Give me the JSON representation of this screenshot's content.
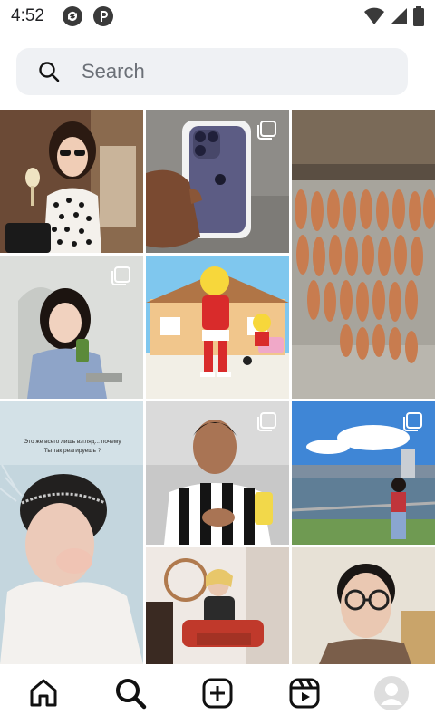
{
  "status_bar": {
    "time": "4:52",
    "icons": [
      "sync-icon",
      "app-icon",
      "wifi-icon",
      "signal-icon",
      "battery-icon"
    ]
  },
  "search": {
    "placeholder": "Search"
  },
  "grid": {
    "tiles": [
      {
        "subject": "woman-polka-dot-dress",
        "multi": false
      },
      {
        "subject": "phone-in-hand",
        "multi": true
      },
      {
        "subject": "dried-fish-rack",
        "multi": false
      },
      {
        "subject": "woman-with-drink",
        "multi": true
      },
      {
        "subject": "cartoon-footballer",
        "multi": false
      },
      {
        "subject": "woman-headpiece",
        "multi": false,
        "caption_line1": "Это же всего лишь взгляд... почему",
        "caption_line2": "Ты так реагируешь ?"
      },
      {
        "subject": "footballer-striped-kit",
        "multi": true
      },
      {
        "subject": "woman-by-lake",
        "multi": true
      },
      {
        "subject": "woman-on-chair",
        "multi": false
      },
      {
        "subject": "man-with-glasses",
        "multi": false
      }
    ]
  },
  "bottom_nav": {
    "items": [
      "home-icon",
      "search-icon",
      "create-icon",
      "reels-icon",
      "profile-avatar"
    ],
    "active": "search-icon"
  },
  "colors": {
    "search_bg": "#eff1f4",
    "placeholder": "#6b7077",
    "icon": "#111111"
  }
}
